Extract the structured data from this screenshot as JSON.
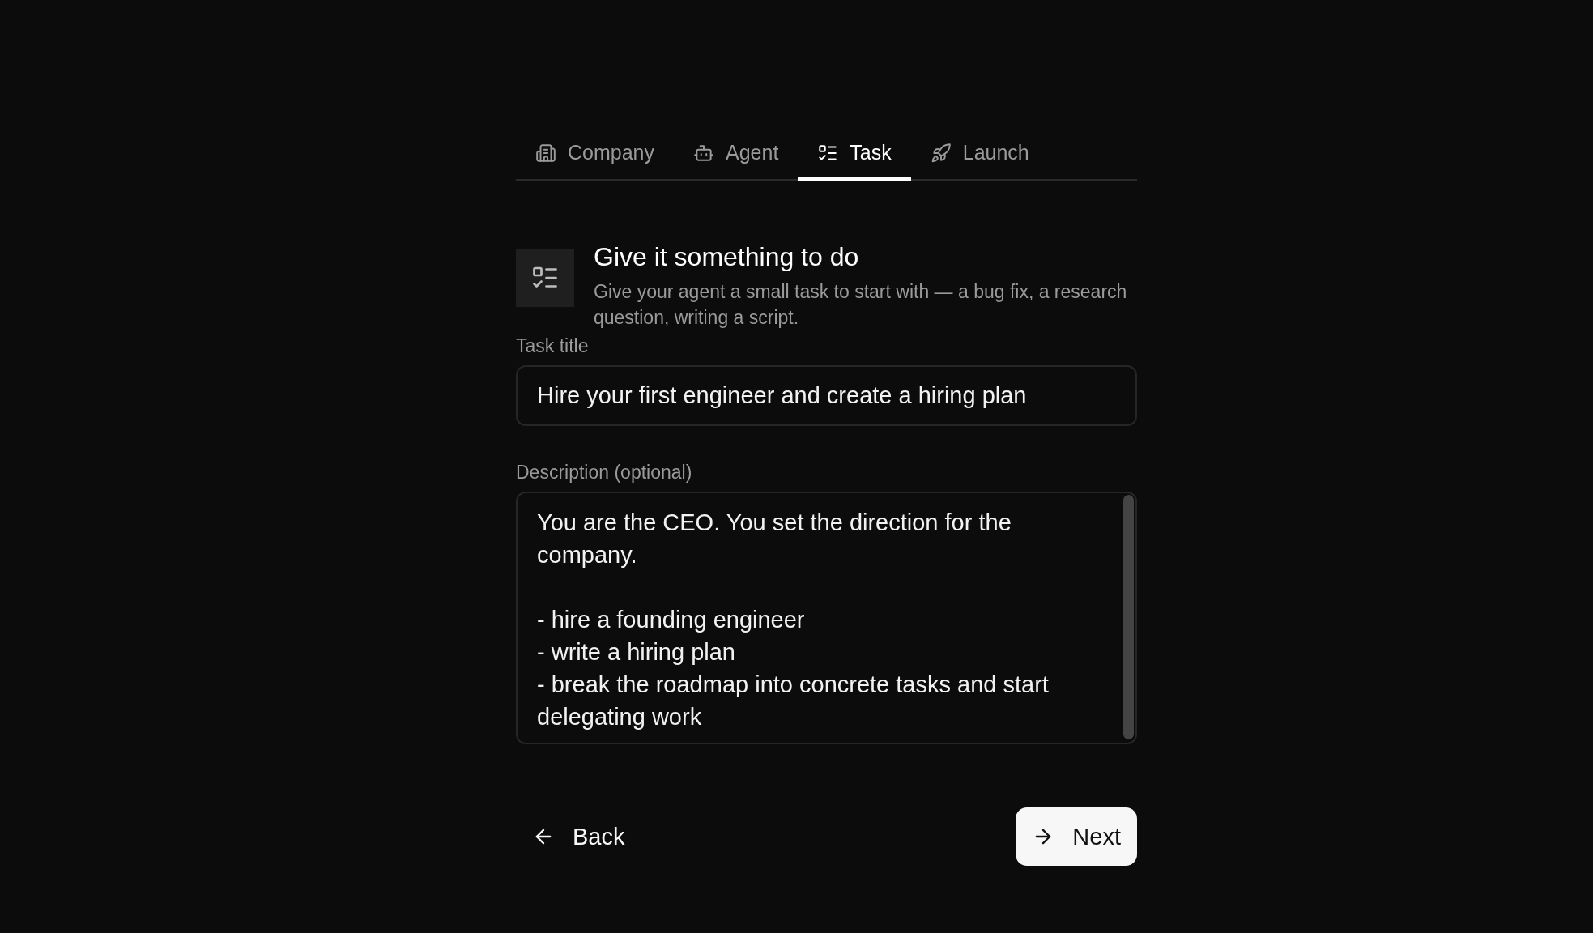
{
  "tabs": [
    {
      "label": "Company",
      "selected": false
    },
    {
      "label": "Agent",
      "selected": false
    },
    {
      "label": "Task",
      "selected": true
    },
    {
      "label": "Launch",
      "selected": false
    }
  ],
  "header": {
    "title": "Give it something to do",
    "subtitle": "Give your agent a small task to start with — a bug fix, a research question, writing a script."
  },
  "task_title": {
    "label": "Task title",
    "value": "Hire your first engineer and create a hiring plan"
  },
  "description": {
    "label": "Description (optional)",
    "value": "You are the CEO. You set the direction for the company.\n\n- hire a founding engineer\n- write a hiring plan\n- break the roadmap into concrete tasks and start delegating work"
  },
  "buttons": [
    {
      "label": "Back",
      "kind": "back"
    },
    {
      "label": "Next",
      "kind": "next"
    }
  ]
}
